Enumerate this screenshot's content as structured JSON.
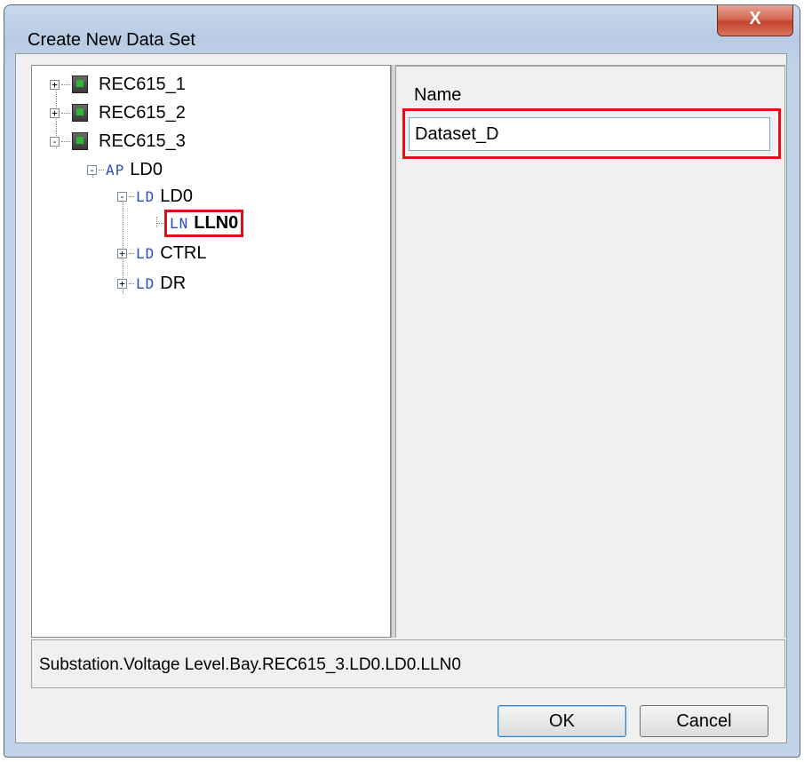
{
  "window": {
    "title": "Create New Data Set",
    "close_glyph": "X"
  },
  "tree": {
    "nodes": [
      {
        "label": "REC615_1",
        "expander": "+"
      },
      {
        "label": "REC615_2",
        "expander": "+"
      },
      {
        "label": "REC615_3",
        "expander": "-"
      },
      {
        "code": "AP",
        "label": "LD0",
        "expander": "-"
      },
      {
        "code": "LD",
        "label": "LD0",
        "expander": "-"
      },
      {
        "code": "LN",
        "label": "LLN0"
      },
      {
        "code": "LD",
        "label": "CTRL",
        "expander": "+"
      },
      {
        "code": "LD",
        "label": "DR",
        "expander": "+"
      }
    ]
  },
  "form": {
    "name_label": "Name",
    "name_value": "Dataset_D"
  },
  "status": {
    "path": "Substation.Voltage Level.Bay.REC615_3.LD0.LD0.LLN0"
  },
  "buttons": {
    "ok": "OK",
    "cancel": "Cancel"
  },
  "colors": {
    "highlight": "#e0101a",
    "node_type_code": "#2a4fb8"
  }
}
